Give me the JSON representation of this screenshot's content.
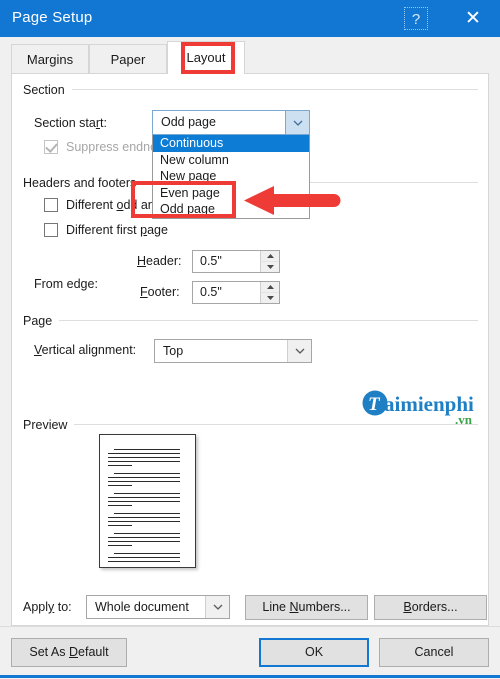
{
  "window": {
    "title": "Page Setup",
    "help_icon": "?",
    "close_icon": "✕"
  },
  "tabs": [
    {
      "label": "Margins",
      "active": false
    },
    {
      "label": "Paper",
      "active": false
    },
    {
      "label": "Layout",
      "active": true
    }
  ],
  "groups": {
    "section": {
      "label": "Section"
    },
    "headers_footers": {
      "label": "Headers and footers"
    },
    "page": {
      "label": "Page"
    },
    "preview": {
      "label": "Preview"
    }
  },
  "section": {
    "section_start_label": "Section start:",
    "section_start_value": "Odd page",
    "dropdown_options": [
      {
        "label": "Continuous",
        "selected": true
      },
      {
        "label": "New column",
        "selected": false
      },
      {
        "label": "New page",
        "selected": false
      },
      {
        "label": "Even page",
        "selected": false
      },
      {
        "label": "Odd page",
        "selected": false
      }
    ],
    "suppress_endnotes_label": "Suppress endnotes",
    "suppress_endnotes_checked": true,
    "suppress_endnotes_enabled": false
  },
  "headers_footers": {
    "different_odd_even_label": "Different odd and even",
    "different_odd_even_checked": false,
    "different_first_page_label": "Different first page",
    "different_first_page_checked": false,
    "from_edge_label": "From edge:",
    "header_label": "Header:",
    "header_value": "0.5\"",
    "footer_label": "Footer:",
    "footer_value": "0.5\""
  },
  "page": {
    "vertical_alignment_label": "Vertical alignment:",
    "vertical_alignment_value": "Top"
  },
  "bottom": {
    "apply_to_label": "Apply to:",
    "apply_to_value": "Whole document",
    "line_numbers_label": "Line Numbers...",
    "borders_label": "Borders..."
  },
  "footer_buttons": {
    "set_as_default_label": "Set As Default",
    "ok_label": "OK",
    "cancel_label": "Cancel"
  },
  "watermark": {
    "brand_letter": "T",
    "brand_text": "aimienphi",
    "brand_tld": ".vn",
    "brand_color": "#1f7fc4",
    "tld_color": "#3aa44a"
  },
  "annotations": {
    "layout_tab_highlight_color": "#ef3b36",
    "dropdown_highlight_color": "#ef3b36",
    "arrow_color": "#ef3b36",
    "arrow_direction": "left"
  },
  "theme": {
    "titlebar_color": "#1277d3",
    "dialog_background": "#f0f0f0",
    "panel_background": "#ffffff",
    "selection_color": "#0c7cd5"
  }
}
